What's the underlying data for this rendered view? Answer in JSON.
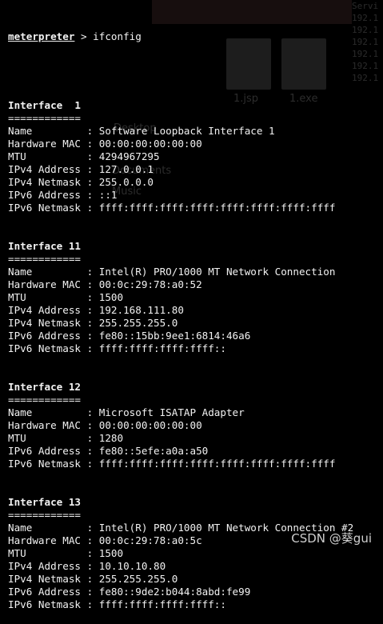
{
  "prompt": {
    "label": "meterpreter",
    "command": "ifconfig",
    "separator": " > "
  },
  "interfaces": [
    {
      "title": "Interface  1",
      "underline": "============",
      "rows": [
        [
          "Name        ",
          "Software Loopback Interface 1"
        ],
        [
          "Hardware MAC",
          "00:00:00:00:00:00"
        ],
        [
          "MTU         ",
          "4294967295"
        ],
        [
          "IPv4 Address",
          "127.0.0.1"
        ],
        [
          "IPv4 Netmask",
          "255.0.0.0"
        ],
        [
          "IPv6 Address",
          "::1"
        ],
        [
          "IPv6 Netmask",
          "ffff:ffff:ffff:ffff:ffff:ffff:ffff:ffff"
        ]
      ]
    },
    {
      "title": "Interface 11",
      "underline": "============",
      "rows": [
        [
          "Name        ",
          "Intel(R) PRO/1000 MT Network Connection"
        ],
        [
          "Hardware MAC",
          "00:0c:29:78:a0:52"
        ],
        [
          "MTU         ",
          "1500"
        ],
        [
          "IPv4 Address",
          "192.168.111.80"
        ],
        [
          "IPv4 Netmask",
          "255.255.255.0"
        ],
        [
          "IPv6 Address",
          "fe80::15bb:9ee1:6814:46a6"
        ],
        [
          "IPv6 Netmask",
          "ffff:ffff:ffff:ffff::"
        ]
      ]
    },
    {
      "title": "Interface 12",
      "underline": "============",
      "rows": [
        [
          "Name        ",
          "Microsoft ISATAP Adapter"
        ],
        [
          "Hardware MAC",
          "00:00:00:00:00:00"
        ],
        [
          "MTU         ",
          "1280"
        ],
        [
          "IPv6 Address",
          "fe80::5efe:a0a:a50"
        ],
        [
          "IPv6 Netmask",
          "ffff:ffff:ffff:ffff:ffff:ffff:ffff:ffff"
        ]
      ]
    },
    {
      "title": "Interface 13",
      "underline": "============",
      "rows": [
        [
          "Name        ",
          "Intel(R) PRO/1000 MT Network Connection #2"
        ],
        [
          "Hardware MAC",
          "00:0c:29:78:a0:5c"
        ],
        [
          "MTU         ",
          "1500"
        ],
        [
          "IPv4 Address",
          "10.10.10.80"
        ],
        [
          "IPv4 Netmask",
          "255.255.255.0"
        ],
        [
          "IPv6 Address",
          "fe80::9de2:b044:8abd:fe99"
        ],
        [
          "IPv6 Netmask",
          "ffff:ffff:ffff:ffff::"
        ]
      ]
    }
  ],
  "watermark": "CSDN @葵gui",
  "background": {
    "serv_label": "Servi",
    "serv_lines": [
      "192.1",
      "192.1",
      "192.1",
      "192.1",
      "192.1",
      "192.1"
    ],
    "tile_labels": [
      "1.jsp",
      "1.exe"
    ],
    "folder_labels": [
      "Desktop",
      "Documents",
      "Music"
    ]
  },
  "colors": {
    "background": "#000000",
    "text": "#f2f2f2",
    "watermark": "#cfcfcf"
  }
}
